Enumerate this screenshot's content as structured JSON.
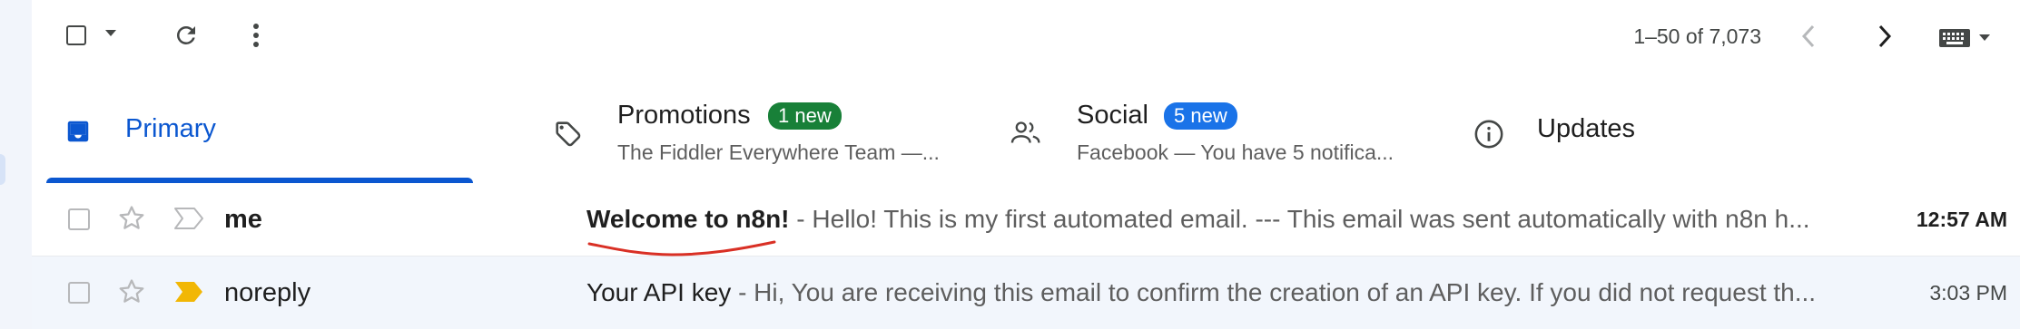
{
  "toolbar": {
    "select_all_icon": "checkbox-icon",
    "select_menu_icon": "caret-down-icon",
    "refresh_icon": "refresh-icon",
    "more_icon": "more-vert-icon",
    "pagination": "1–50 of 7,073",
    "prev_icon": "chevron-left-icon",
    "next_icon": "chevron-right-icon",
    "input_tools_icon": "keyboard-icon"
  },
  "tabs": [
    {
      "label": "Primary",
      "icon": "inbox-icon",
      "active": true
    },
    {
      "label": "Promotions",
      "icon": "tag-icon",
      "badge": "1 new",
      "badge_color": "#188038",
      "subtitle": "The Fiddler Everywhere Team —..."
    },
    {
      "label": "Social",
      "icon": "people-icon",
      "badge": "5 new",
      "badge_color": "#1a73e8",
      "subtitle": "Facebook — You have 5 notifica..."
    },
    {
      "label": "Updates",
      "icon": "info-icon"
    }
  ],
  "emails": [
    {
      "sender": "me",
      "subject": "Welcome to n8n!",
      "snippet": " - Hello! This is my first automated email. --- This email was sent automatically with n8n h...",
      "time": "12:57 AM",
      "unread": true,
      "important": false,
      "annotation_color": "#d93025"
    },
    {
      "sender": "noreply",
      "subject": "Your API key",
      "snippet": " - Hi, You are receiving this email to confirm the creation of an API key. If you did not request th...",
      "time": "3:03 PM",
      "unread": false,
      "important": true,
      "important_color": "#f2b705"
    }
  ],
  "colors": {
    "accent": "#0b57d0",
    "background": "#f2f5fb"
  }
}
